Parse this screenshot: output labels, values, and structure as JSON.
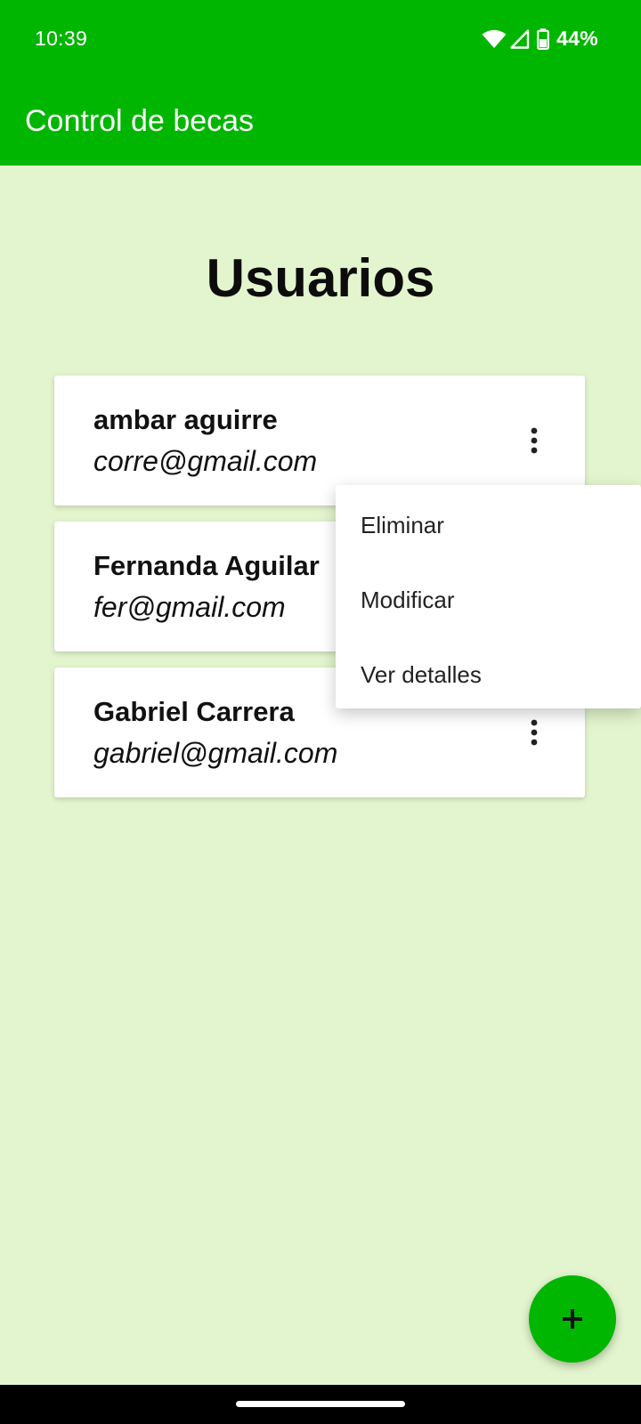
{
  "status_bar": {
    "time": "10:39",
    "battery_percent": "44%",
    "icons": [
      "wifi-icon",
      "cell-signal-icon",
      "battery-icon"
    ]
  },
  "app_bar": {
    "title": "Control de becas",
    "color": "#00b600"
  },
  "page": {
    "title": "Usuarios",
    "background": "#e3f5ce"
  },
  "users": [
    {
      "name": "ambar aguirre",
      "email": "corre@gmail.com"
    },
    {
      "name": "Fernanda Aguilar",
      "email": "fer@gmail.com"
    },
    {
      "name": "Gabriel Carrera",
      "email": "gabriel@gmail.com"
    }
  ],
  "popup_menu": {
    "items": [
      "Eliminar",
      "Modificar",
      "Ver detalles"
    ]
  },
  "fab": {
    "icon": "plus-icon",
    "color": "#00b600"
  }
}
